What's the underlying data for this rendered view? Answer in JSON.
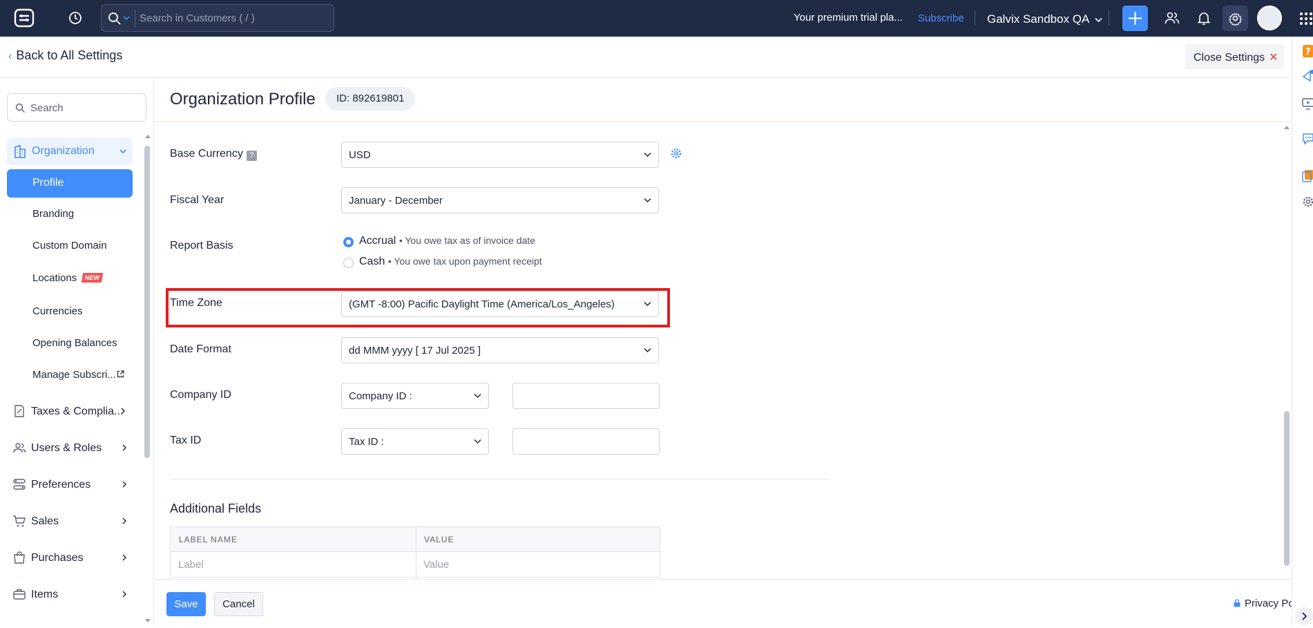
{
  "topbar": {
    "search_placeholder": "Search in Customers ( / )",
    "trial_text": "Your premium trial pla...",
    "subscribe_label": "Subscribe",
    "org_name": "Galvix Sandbox QA",
    "icons": [
      "app-logo-icon",
      "history-icon",
      "search-icon",
      "plus-icon",
      "users-icon",
      "bell-icon",
      "gear-icon",
      "avatar",
      "apps-grid-icon"
    ]
  },
  "header": {
    "back_label": "Back to All Settings",
    "close_label": "Close Settings"
  },
  "sidebar": {
    "search_placeholder": "Search",
    "organization_label": "Organization",
    "profile_label": "Profile",
    "sub_items": [
      {
        "label": "Branding"
      },
      {
        "label": "Custom Domain"
      },
      {
        "label": "Locations",
        "badge": "NEW"
      },
      {
        "label": "Currencies"
      },
      {
        "label": "Opening Balances"
      },
      {
        "label": "Manage Subscri..."
      }
    ],
    "groups": [
      {
        "label": "Taxes & Complia..."
      },
      {
        "label": "Users & Roles"
      },
      {
        "label": "Preferences"
      },
      {
        "label": "Sales"
      },
      {
        "label": "Purchases"
      },
      {
        "label": "Items"
      }
    ]
  },
  "main": {
    "title": "Organization Profile",
    "id_badge": "ID: 892619801",
    "fields": {
      "base_currency": {
        "label": "Base Currency",
        "help": "?",
        "value": "USD"
      },
      "fiscal_year": {
        "label": "Fiscal Year",
        "value": "January - December"
      },
      "report_basis": {
        "label": "Report Basis",
        "options": [
          {
            "label": "Accrual",
            "desc": "• You owe tax as of invoice date",
            "selected": true
          },
          {
            "label": "Cash",
            "desc": "• You owe tax upon payment receipt",
            "selected": false
          }
        ]
      },
      "time_zone": {
        "label": "Time Zone",
        "value": "(GMT -8:00) Pacific Daylight Time (America/Los_Angeles)"
      },
      "date_format": {
        "label": "Date Format",
        "value": "dd MMM yyyy [ 17 Jul 2025 ]"
      },
      "company_id": {
        "label": "Company ID",
        "select_value": "Company ID :",
        "input_value": ""
      },
      "tax_id": {
        "label": "Tax ID",
        "select_value": "Tax ID :",
        "input_value": ""
      }
    },
    "additional_fields": {
      "title": "Additional Fields",
      "columns": [
        "LABEL NAME",
        "VALUE"
      ],
      "row_placeholders": [
        "Label",
        "Value"
      ]
    }
  },
  "footer": {
    "save_label": "Save",
    "cancel_label": "Cancel",
    "privacy_label": "Privacy Policy"
  },
  "colors": {
    "topbar_bg": "#1f2a44",
    "accent": "#408dfb",
    "highlight_border": "#e21e1e",
    "new_badge": "#f25555"
  }
}
